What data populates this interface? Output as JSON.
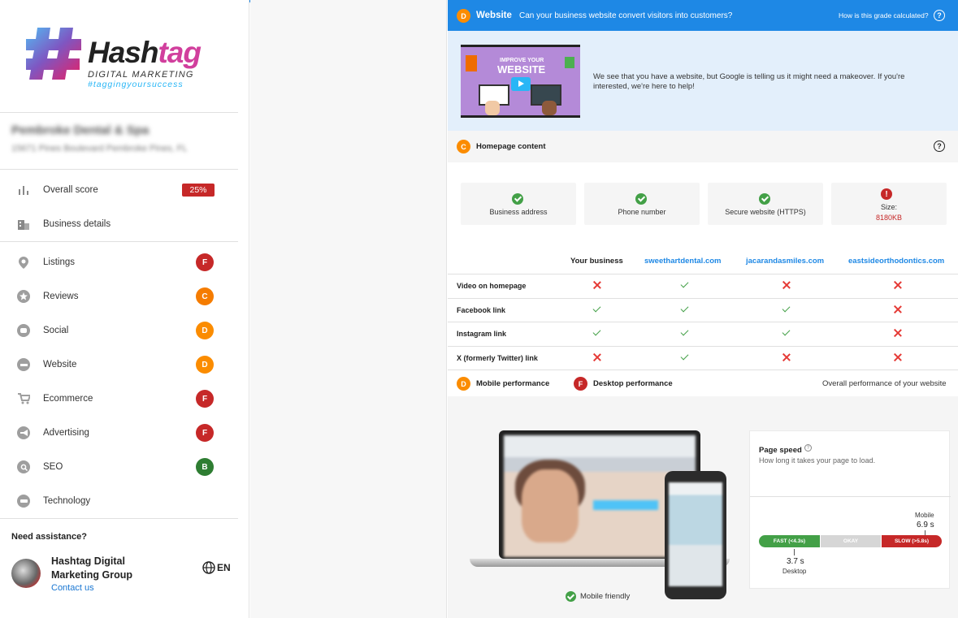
{
  "sidebar": {
    "logo": {
      "word_main": "Hash",
      "word_accent": "tag",
      "subtitle": "DIGITAL MARKETING",
      "tagline": "#taggingyoursuccess"
    },
    "business": {
      "name": "Pembroke Dental & Spa",
      "address": "15671 Pines Boulevard Pembroke Pines, FL"
    },
    "overall": {
      "label": "Overall score",
      "value": "25%"
    },
    "business_details_label": "Business details",
    "items": [
      {
        "label": "Listings",
        "grade": "F"
      },
      {
        "label": "Reviews",
        "grade": "C"
      },
      {
        "label": "Social",
        "grade": "D"
      },
      {
        "label": "Website",
        "grade": "D"
      },
      {
        "label": "Ecommerce",
        "grade": "F"
      },
      {
        "label": "Advertising",
        "grade": "F"
      },
      {
        "label": "SEO",
        "grade": "B"
      },
      {
        "label": "Technology",
        "grade": ""
      }
    ],
    "assistance": {
      "heading": "Need assistance?",
      "agent": "Hashtag Digital Marketing Group",
      "contact": "Contact us",
      "lang": "EN"
    }
  },
  "panel": {
    "header": {
      "grade": "D",
      "title": "Website",
      "question": "Can your business website convert visitors into customers?",
      "how": "How is this grade calculated?"
    },
    "video": {
      "thumb_line1": "IMPROVE YOUR",
      "thumb_line2": "WEBSITE",
      "text": "We see that you have a website, but Google is telling us it might need a makeover. If you're interested, we're here to help!"
    },
    "homepage": {
      "grade": "C",
      "label": "Homepage content"
    },
    "cards": [
      {
        "label": "Business address",
        "ok": true,
        "value": ""
      },
      {
        "label": "Phone number",
        "ok": true,
        "value": ""
      },
      {
        "label": "Secure website (HTTPS)",
        "ok": true,
        "value": ""
      },
      {
        "label": "Size:",
        "ok": false,
        "value": "8180KB"
      }
    ],
    "table": {
      "columns": [
        "Your business",
        "sweethartdental.com",
        "jacarandasmiles.com",
        "eastsideorthodontics.com"
      ],
      "rows": [
        {
          "label": "Video on homepage",
          "marks": [
            false,
            true,
            false,
            false
          ]
        },
        {
          "label": "Facebook link",
          "marks": [
            true,
            true,
            true,
            false
          ]
        },
        {
          "label": "Instagram link",
          "marks": [
            true,
            true,
            true,
            false
          ]
        },
        {
          "label": "X (formerly Twitter) link",
          "marks": [
            false,
            true,
            false,
            false
          ]
        }
      ]
    },
    "performance": {
      "mobile_grade": "D",
      "mobile_label": "Mobile performance",
      "desktop_grade": "F",
      "desktop_label": "Desktop performance",
      "overall": "Overall performance of your website",
      "mobile_friendly": "Mobile friendly",
      "speed": {
        "title": "Page speed",
        "desc": "How long it takes your page to load.",
        "fast": "FAST (<4.3s)",
        "okay": "OKAY",
        "slow": "SLOW (>5.8s)",
        "mobile_label": "Mobile",
        "mobile_value": "6.9 s",
        "desktop_label": "Desktop",
        "desktop_value": "3.7 s"
      }
    }
  }
}
